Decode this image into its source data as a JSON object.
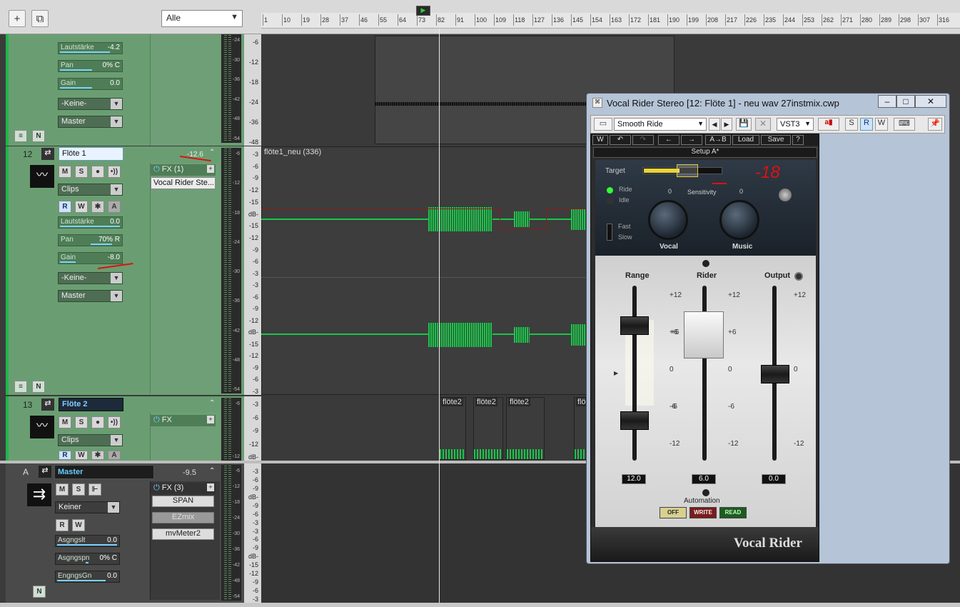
{
  "toolbar": {
    "filter_value": "Alle"
  },
  "ruler": {
    "marks": [
      "1",
      "10",
      "19",
      "28",
      "37",
      "46",
      "55",
      "64",
      "73",
      "82",
      "91",
      "100",
      "109",
      "118",
      "127",
      "136",
      "145",
      "154",
      "163",
      "172",
      "181",
      "190",
      "199",
      "208",
      "217",
      "226",
      "235",
      "244",
      "253",
      "262",
      "271",
      "280",
      "289",
      "298",
      "307",
      "316"
    ]
  },
  "track_top": {
    "volume_label": "Lautstärke",
    "volume_value": "-4.2",
    "pan_label": "Pan",
    "pan_value": "0% C",
    "gain_label": "Gain",
    "gain_value": "0.0",
    "input": "-Keine-",
    "output": "Master"
  },
  "track12": {
    "number": "12",
    "name": "Flöte 1",
    "peak": "-12.6",
    "mute": "M",
    "solo": "S",
    "mode": "Clips",
    "arm_r": "R",
    "arm_w": "W",
    "arm_a": "A",
    "volume_label": "Lautstärke",
    "volume_value": "0.0",
    "pan_label": "Pan",
    "pan_value": "70% R",
    "gain_label": "Gain",
    "gain_value": "-8.0",
    "input": "-Keine-",
    "output": "Master",
    "fx_label": "FX (1)",
    "fx_item": "Vocal Rider Ste...",
    "clip_name": "flöte1_neu (336)"
  },
  "track13": {
    "number": "13",
    "name": "Flöte 2",
    "mute": "M",
    "solo": "S",
    "mode": "Clips",
    "arm_r": "R",
    "arm_w": "W",
    "arm_a": "A",
    "fx_label": "FX",
    "clips": [
      "flöte2",
      "flöte2",
      "flöte2",
      "flö"
    ]
  },
  "master": {
    "letter": "A",
    "name": "Master",
    "peak": "-9.5",
    "mute": "M",
    "solo": "S",
    "route": "Keiner",
    "arm_r": "R",
    "arm_w": "W",
    "send_level_label": "Asgngslt",
    "send_level_value": "0.0",
    "send_pan_label": "Asgngspn",
    "send_pan_value": "0% C",
    "in_gain_label": "EngngsGn",
    "in_gain_value": "0.0",
    "fx_label": "FX (3)",
    "fx_items": [
      "SPAN",
      "EZmix",
      "mvMeter2"
    ]
  },
  "scales": {
    "top": [
      "-6",
      "-12",
      "-18",
      "-24",
      "-36",
      "-48"
    ],
    "t12a": [
      "-3",
      "-6",
      "-9",
      "-12",
      "-15",
      "dB-",
      "-15",
      "-12",
      "-9",
      "-6",
      "-3"
    ],
    "t12b": [
      "-3",
      "-6",
      "-9",
      "-12",
      "dB-",
      "-15",
      "-12",
      "-9",
      "-6",
      "-3"
    ],
    "t13": [
      "-3",
      "-6",
      "-9",
      "-12",
      "dB-"
    ],
    "master": [
      "-3",
      "-6",
      "-9",
      "dB-",
      "-9",
      "-6",
      "-3",
      "-3",
      "-6",
      "-9",
      "dB-",
      "-15",
      "-12",
      "-9",
      "-6",
      "-3"
    ]
  },
  "meters": {
    "top": [
      "-24",
      "-30",
      "-36",
      "-42",
      "-48",
      "-54"
    ],
    "t12": [
      "-6",
      "-12",
      "-18",
      "-24",
      "-30",
      "-36",
      "-42",
      "-48",
      "-54"
    ],
    "t13": [
      "-6",
      "-12"
    ],
    "master": [
      "-6",
      "-12",
      "-18",
      "-24",
      "-30",
      "-36",
      "-42",
      "-48",
      "-54"
    ]
  },
  "plugin": {
    "title": "Vocal Rider Stereo [12: Flöte 1] - neu wav 27instmix.cwp",
    "preset": "Smooth Ride",
    "format": "VST3",
    "btn_s": "S",
    "btn_r": "R",
    "btn_w": "W",
    "waves_toolbar": {
      "ab": "A→B",
      "load": "Load",
      "save": "Save",
      "help": "?"
    },
    "setup": "Setup A*",
    "target_label": "Target",
    "handwritten_note": "-18",
    "ride_label": "Ride",
    "idle_label": "Idle",
    "sensitivity_label": "Sensitivity",
    "vocal_label": "Vocal",
    "music_label": "Music",
    "vocal_zero": "0",
    "music_zero": "0",
    "fast_label": "Fast",
    "slow_label": "Slow",
    "range_label": "Range",
    "rider_label": "Rider",
    "output_label": "Output",
    "scale_ticks": [
      "+12",
      "+6",
      "0",
      "-6",
      "-12"
    ],
    "range_value": "12.0",
    "rider_value": "6.0",
    "output_value": "0.0",
    "automation_label": "Automation",
    "automation": [
      "OFF",
      "WRITE",
      "READ"
    ],
    "brand": "Vocal Rider"
  }
}
